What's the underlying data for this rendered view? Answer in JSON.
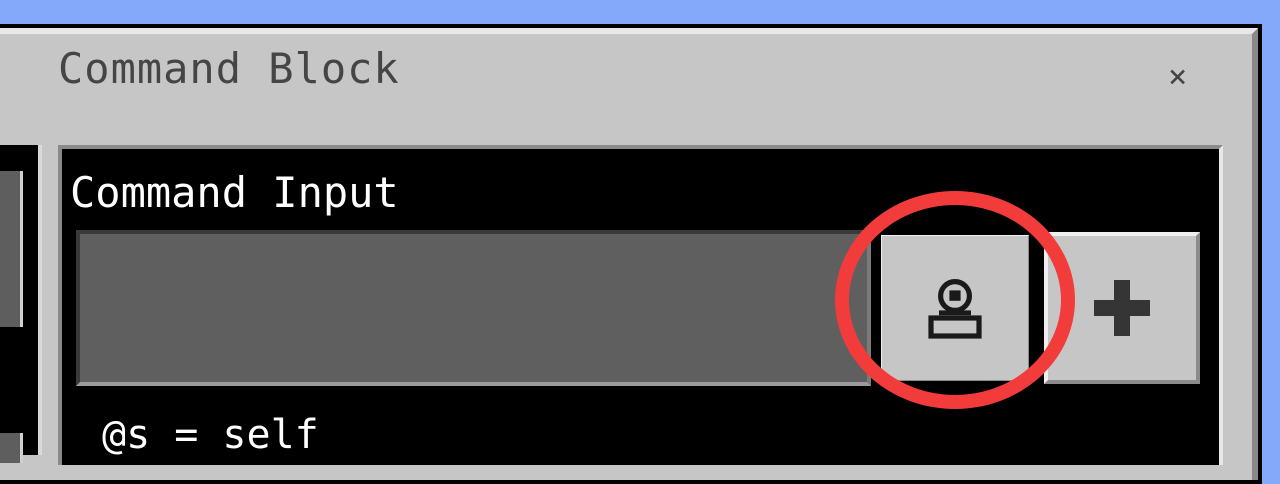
{
  "window": {
    "title": "Command Block",
    "close_label": "×"
  },
  "command": {
    "label": "Command Input",
    "value": "",
    "placeholder": ""
  },
  "buttons": {
    "select_icon": "selector-icon",
    "add_label": "+"
  },
  "hint": {
    "text": "@s = self"
  },
  "colors": {
    "background": "#84a9fa",
    "window": "#c6c6c6",
    "highlight": "#f23b3b"
  }
}
